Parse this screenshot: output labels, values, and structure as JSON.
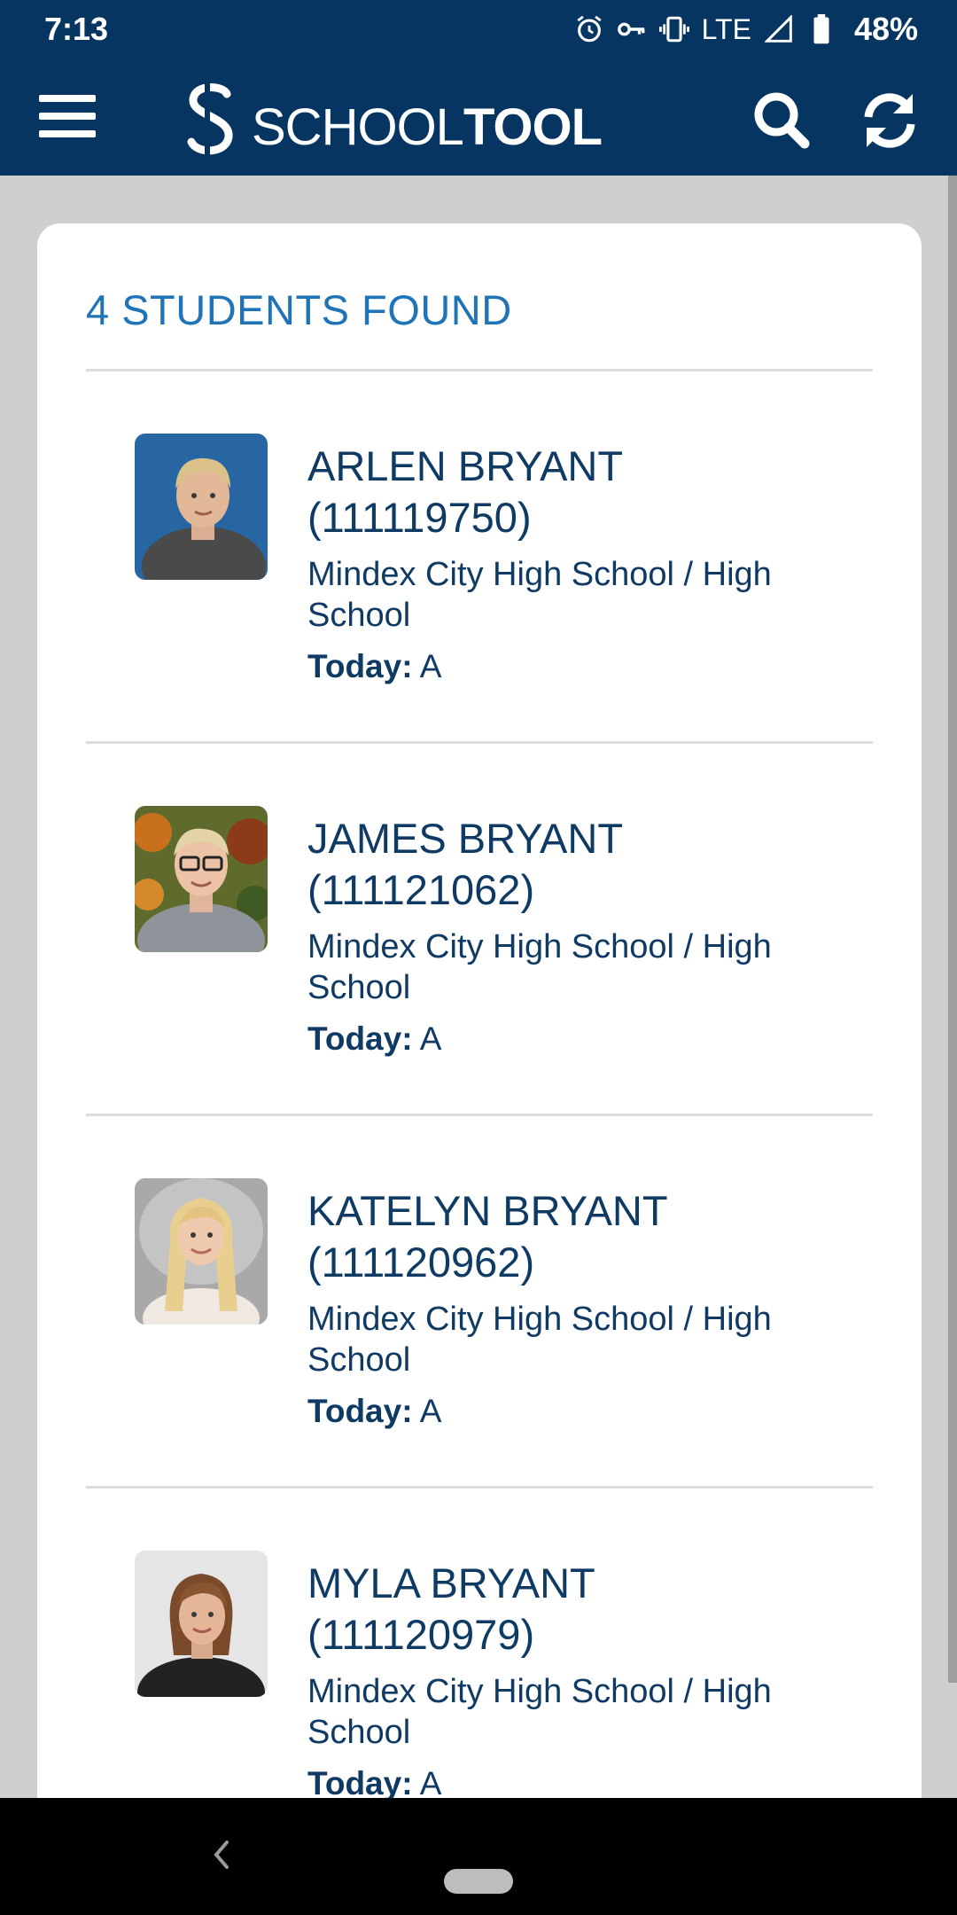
{
  "status": {
    "time": "7:13",
    "network": "LTE",
    "battery": "48%"
  },
  "app": {
    "logo_light": "SCHOOL",
    "logo_bold": "TOOL"
  },
  "results": {
    "title": "4 STUDENTS FOUND"
  },
  "students": [
    {
      "name": "ARLEN BRYANT",
      "id": "(111119750)",
      "school": "Mindex City High School / High School",
      "today_label": "Today:",
      "today_value": " A"
    },
    {
      "name": "JAMES BRYANT",
      "id": "(111121062)",
      "school": "Mindex City High School / High School",
      "today_label": "Today:",
      "today_value": " A"
    },
    {
      "name": "KATELYN BRYANT",
      "id": "(111120962)",
      "school": "Mindex City High School / High School",
      "today_label": "Today:",
      "today_value": " A"
    },
    {
      "name": "MYLA BRYANT",
      "id": "(111120979)",
      "school": "Mindex City High School / High School",
      "today_label": "Today:",
      "today_value": " A"
    }
  ],
  "colors": {
    "header": "#053560",
    "accent": "#1f73b7",
    "text": "#0f3a64"
  },
  "icons": [
    "menu-icon",
    "logo-icon",
    "search-icon",
    "refresh-icon",
    "alarm-icon",
    "vpn-key-icon",
    "vibrate-icon",
    "signal-icon",
    "battery-icon",
    "back-icon"
  ]
}
